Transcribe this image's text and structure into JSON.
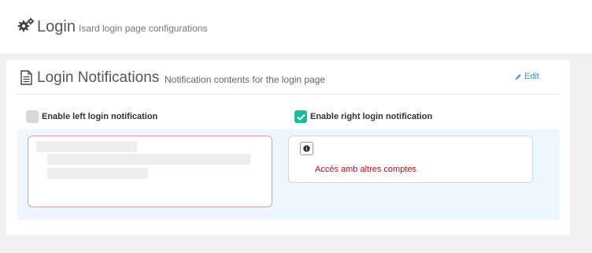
{
  "header": {
    "title": "Login",
    "subtitle": "Isard login page configurations",
    "icon": "gears-icon"
  },
  "card": {
    "title": "Login Notifications",
    "subtitle": "Notification contents for the login page",
    "icon": "document-icon",
    "edit_label": "Edit"
  },
  "left": {
    "checkbox_label": "Enable left login notification",
    "checked": false
  },
  "right": {
    "checkbox_label": "Enable right login notification",
    "checked": true,
    "notification_text": "Accés amb altres comptes"
  },
  "colors": {
    "accent_checkbox": "#1abb9c",
    "link": "#4a90c6",
    "notification_text": "#b01515",
    "area_bg": "#eef6fe"
  }
}
